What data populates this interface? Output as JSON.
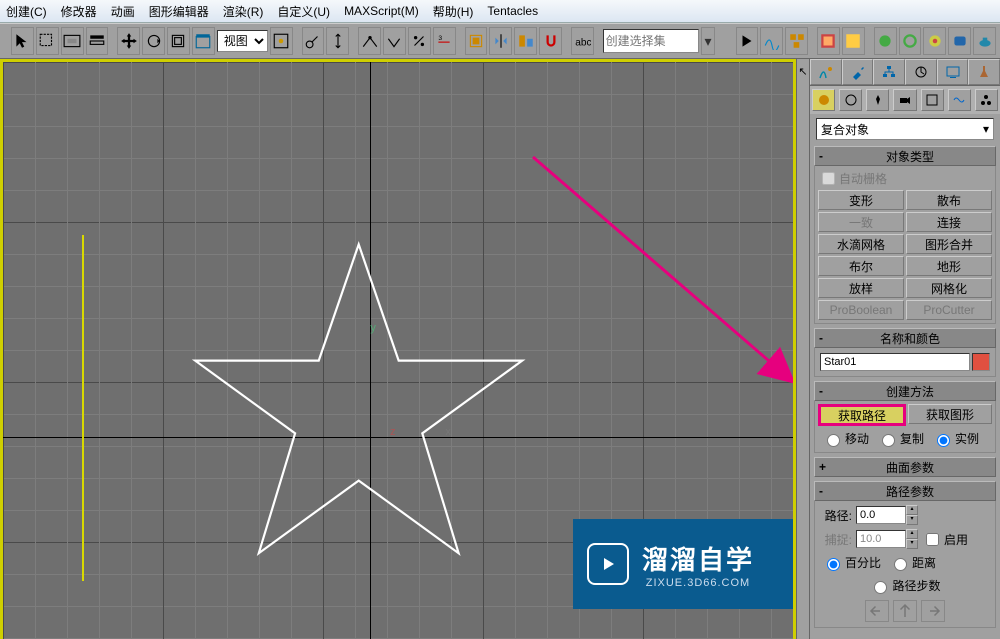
{
  "menubar": [
    "创建(C)",
    "修改器",
    "动画",
    "图形编辑器",
    "渲染(R)",
    "自定义(U)",
    "MAXScript(M)",
    "帮助(H)",
    "Tentacles"
  ],
  "toolbar": {
    "view_combo": "视图",
    "set_combo_placeholder": "创建选择集"
  },
  "cmdpanel": {
    "dropdown": "复合对象",
    "rollout_objecttype": {
      "title": "对象类型",
      "autogrid": "自动栅格",
      "buttons": [
        [
          "变形",
          "散布"
        ],
        [
          "一致",
          "连接"
        ],
        [
          "水滴网格",
          "图形合并"
        ],
        [
          "布尔",
          "地形"
        ],
        [
          "放样",
          "网格化"
        ],
        [
          "ProBoolean",
          "ProCutter"
        ]
      ]
    },
    "rollout_namecolor": {
      "title": "名称和颜色",
      "name": "Star01"
    },
    "rollout_create": {
      "title": "创建方法",
      "get_path": "获取路径",
      "get_shape": "获取图形",
      "radios": [
        "移动",
        "复制",
        "实例"
      ]
    },
    "rollout_surface": {
      "title": "曲面参数"
    },
    "rollout_path": {
      "title": "路径参数",
      "path_lbl": "路径:",
      "path_val": "0.0",
      "snap_lbl": "捕捉:",
      "snap_val": "10.0",
      "enable": "启用",
      "percent": "百分比",
      "distance": "距离",
      "pathsteps": "路径步数"
    }
  },
  "watermark": {
    "big": "溜溜自学",
    "small": "ZIXUE.3D66.COM"
  }
}
